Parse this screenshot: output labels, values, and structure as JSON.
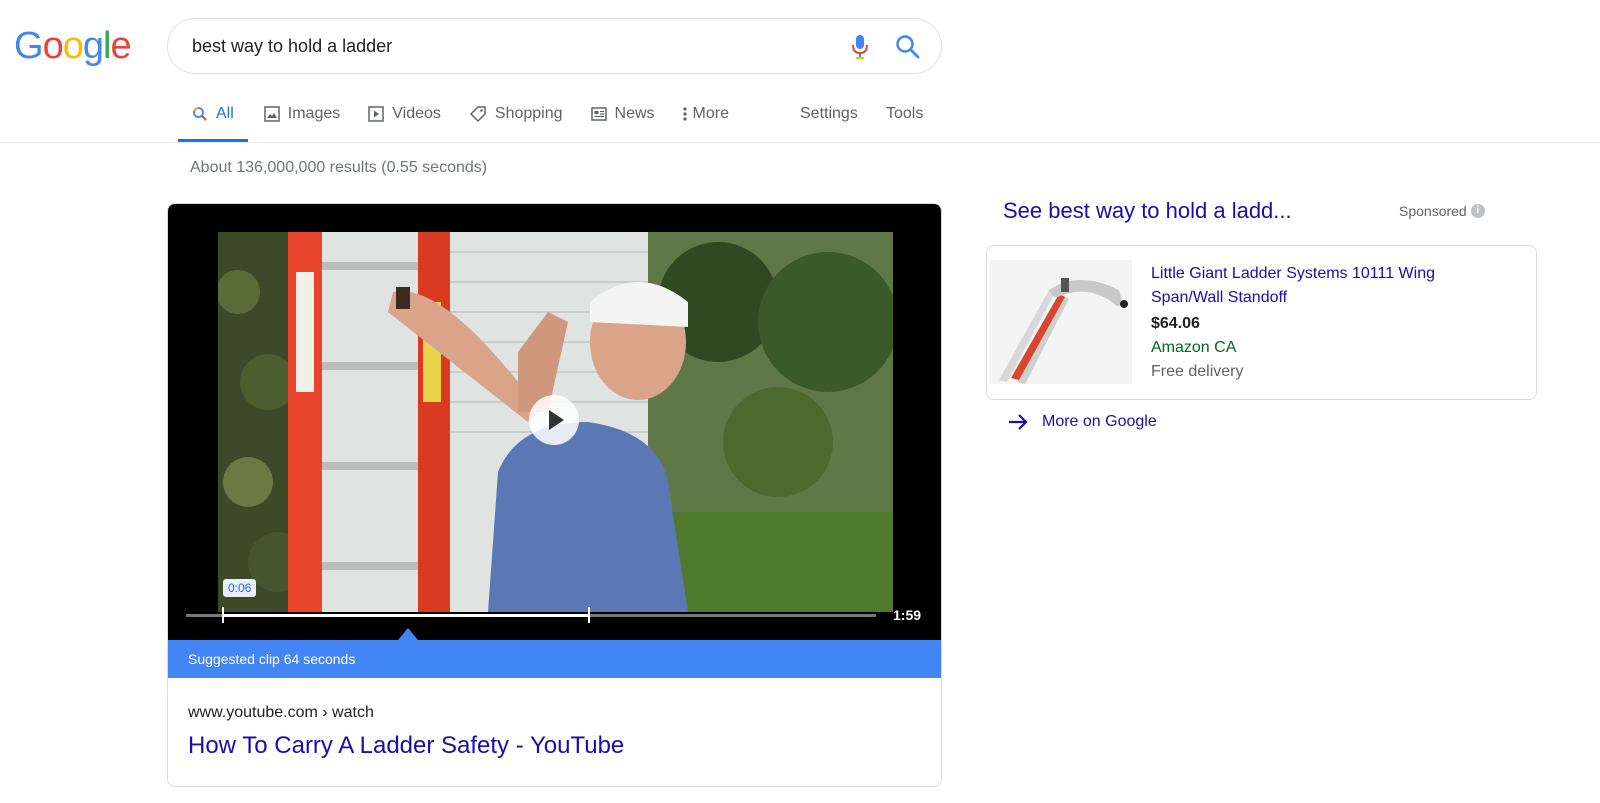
{
  "logo": {
    "letters": [
      "G",
      "o",
      "o",
      "g",
      "l",
      "e"
    ],
    "colors": [
      "#4285f4",
      "#ea4335",
      "#fbbc05",
      "#4285f4",
      "#34a853",
      "#ea4335"
    ]
  },
  "search": {
    "query": "best way to hold a ladder"
  },
  "tabs": [
    {
      "label": "All",
      "icon": "search-icon",
      "active": true
    },
    {
      "label": "Images",
      "icon": "image-icon"
    },
    {
      "label": "Videos",
      "icon": "video-icon"
    },
    {
      "label": "Shopping",
      "icon": "tag-icon"
    },
    {
      "label": "News",
      "icon": "news-icon"
    },
    {
      "label": "More",
      "icon": "more-vert-icon"
    }
  ],
  "tools": {
    "settings": "Settings",
    "tools": "Tools"
  },
  "result_stats": "About 136,000,000 results (0.55 seconds)",
  "video": {
    "timestamp": "0:06",
    "duration": "1:59",
    "clip_label": "Suggested clip 64 seconds",
    "url": "www.youtube.com › watch",
    "title": "How To Carry A Ladder Safety - YouTube"
  },
  "ad": {
    "heading": "See best way to hold a ladd...",
    "sponsored": "Sponsored",
    "product_title": "Little Giant Ladder Systems 10111 Wing Span/Wall Standoff",
    "price": "$64.06",
    "store": "Amazon CA",
    "delivery": "Free delivery",
    "more_link": "More on Google"
  },
  "colors": {
    "link": "#1a0dab",
    "accent": "#1a73e8",
    "clip_bar": "#4285f4",
    "store_green": "#006621"
  }
}
